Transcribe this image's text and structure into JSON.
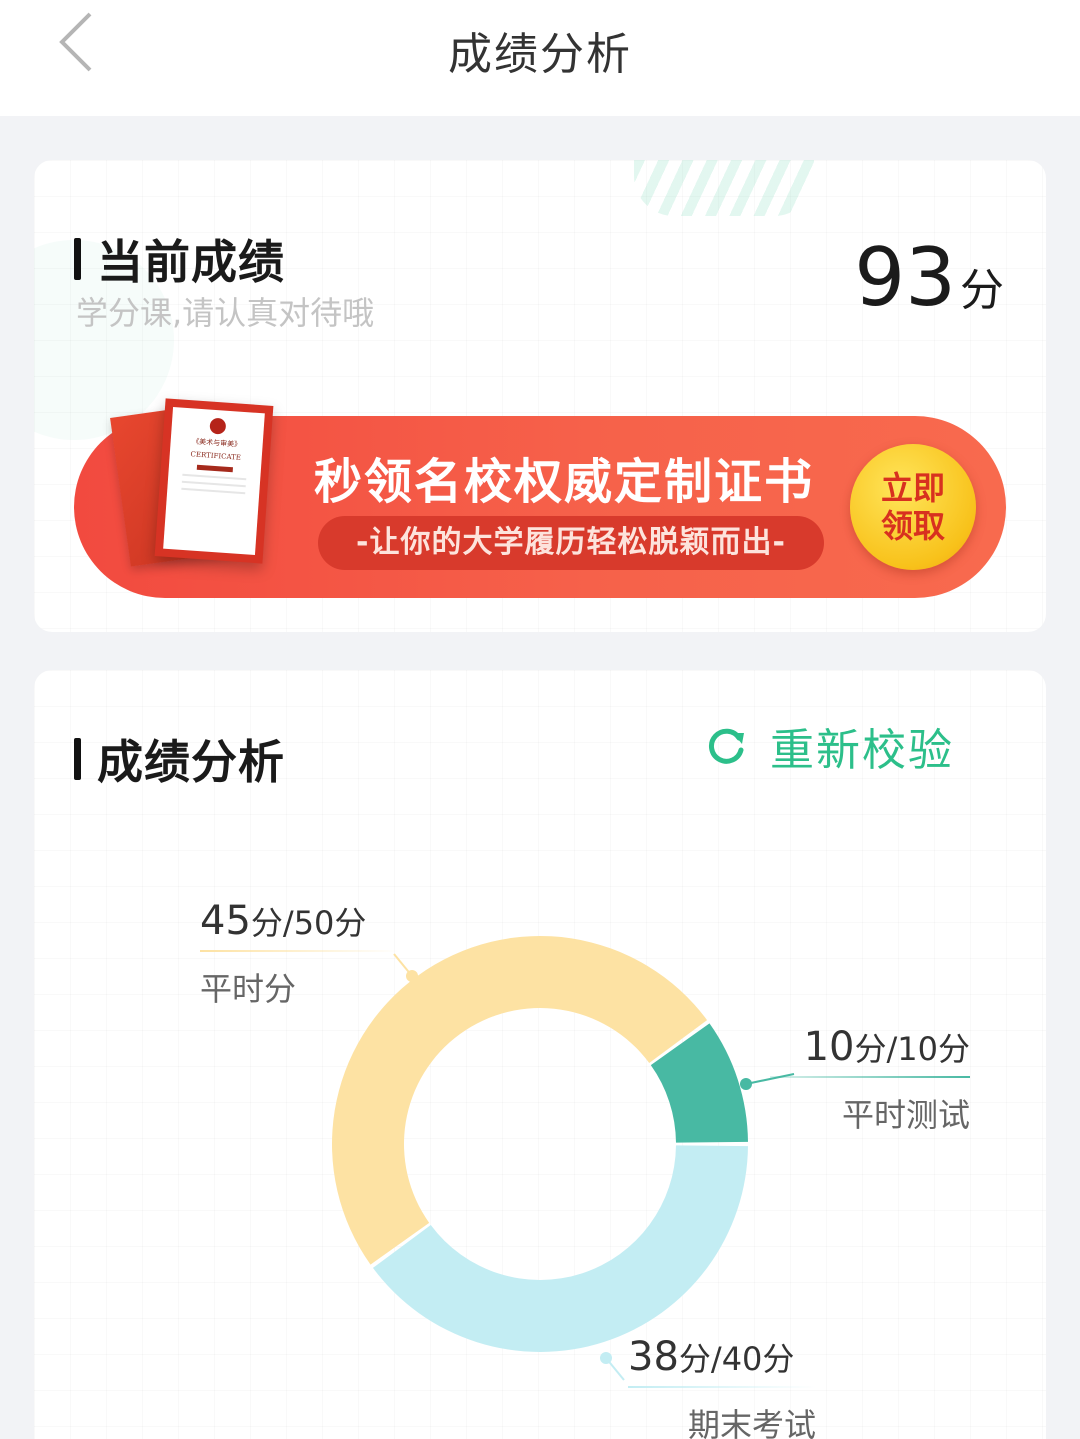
{
  "nav": {
    "title": "成绩分析",
    "back_icon": "chevron-left-icon"
  },
  "current": {
    "heading": "当前成绩",
    "subtitle": "学分课,请认真对待哦",
    "score": "93",
    "score_unit": "分"
  },
  "banner": {
    "headline": "秒领名校权威定制证书",
    "tagline": "-让你的大学履历轻松脱颖而出-",
    "cta_line1": "立即",
    "cta_line2": "领取",
    "cert_text": "《美术与审美》",
    "cert_word": "CERTIFICATE"
  },
  "analysis": {
    "heading": "成绩分析",
    "recheck_label": "重新校验",
    "recheck_icon": "refresh-icon"
  },
  "chart_data": {
    "type": "pie",
    "categories": [
      "平时测试",
      "期末考试",
      "平时分"
    ],
    "values": [
      10,
      40,
      50
    ],
    "scores": [
      10,
      38,
      45
    ],
    "colors": [
      "#48b9a3",
      "#c3edf3",
      "#fde2a3"
    ],
    "labels": [
      {
        "score": "10",
        "total": "分/10分",
        "name": "平时测试"
      },
      {
        "score": "38",
        "total": "分/40分",
        "name": "期末考试"
      },
      {
        "score": "45",
        "total": "分/50分",
        "name": "平时分"
      }
    ]
  }
}
